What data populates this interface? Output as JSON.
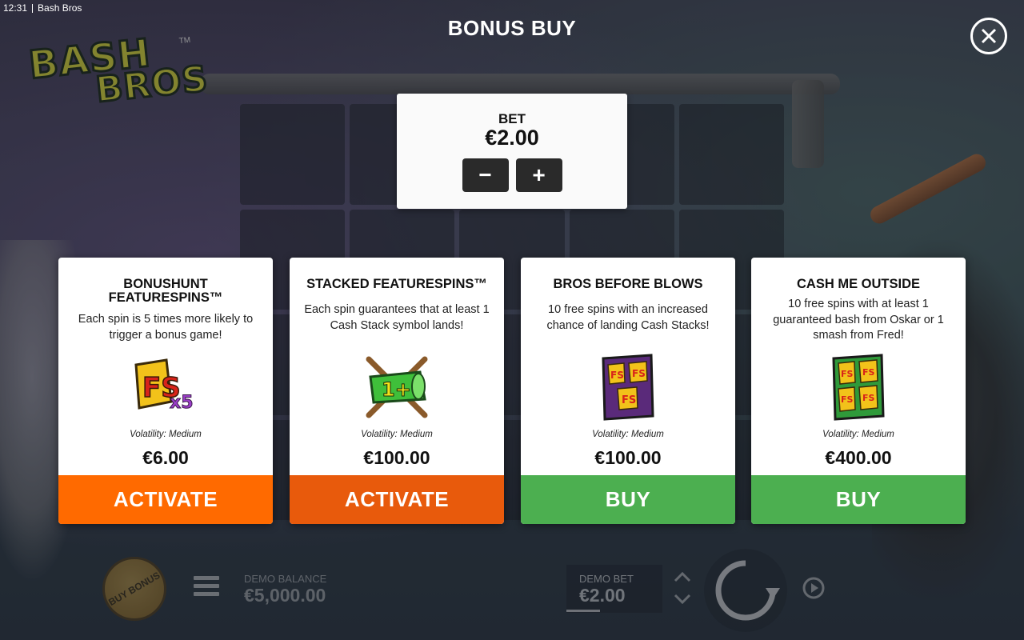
{
  "status_bar": {
    "time": "12:31",
    "app_name": "Bash Bros"
  },
  "logo": {
    "line1": "BASH",
    "line2": "BROS",
    "tm": "TM"
  },
  "modal": {
    "title": "BONUS BUY"
  },
  "bet": {
    "label": "BET",
    "value": "€2.00",
    "decrease": "−",
    "increase": "+"
  },
  "cards": [
    {
      "title": "BONUSHUNT FEATURESPINS™",
      "description": "Each spin is 5 times more likely to trigger a bonus game!",
      "art_label": "FS",
      "art_multiplier": "x5",
      "volatility": "Volatility: Medium",
      "price": "€6.00",
      "action": "ACTIVATE",
      "action_color": "#ff6a00"
    },
    {
      "title": "STACKED FEATURESPINS™",
      "description": "Each spin guarantees that at least 1 Cash Stack symbol lands!",
      "art_label": "1+",
      "volatility": "Volatility: Medium",
      "price": "€100.00",
      "action": "ACTIVATE",
      "action_color": "#e85a0c"
    },
    {
      "title": "BROS BEFORE BLOWS",
      "description": "10 free spins with an increased chance of landing Cash Stacks!",
      "art_label": "FS",
      "volatility": "Volatility: Medium",
      "price": "€100.00",
      "action": "BUY",
      "action_color": "#4caf50"
    },
    {
      "title": "CASH ME OUTSIDE",
      "description": "10 free spins with at least 1 guaranteed bash from Oskar or 1 smash from Fred!",
      "art_label": "FS",
      "volatility": "Volatility: Medium",
      "price": "€400.00",
      "action": "BUY",
      "action_color": "#4caf50"
    }
  ],
  "bottom_bar": {
    "buy_bonus_label": "BUY BONUS",
    "demo_balance_label": "DEMO BALANCE",
    "demo_balance_value": "€5,000.00",
    "demo_bet_label": "DEMO BET",
    "demo_bet_value": "€2.00"
  },
  "icons": {
    "close": "close-icon",
    "menu": "hamburger-menu-icon",
    "spin": "spin-icon",
    "autoplay": "autoplay-icon",
    "bet_arrows": "chevron-up-down-icon"
  }
}
